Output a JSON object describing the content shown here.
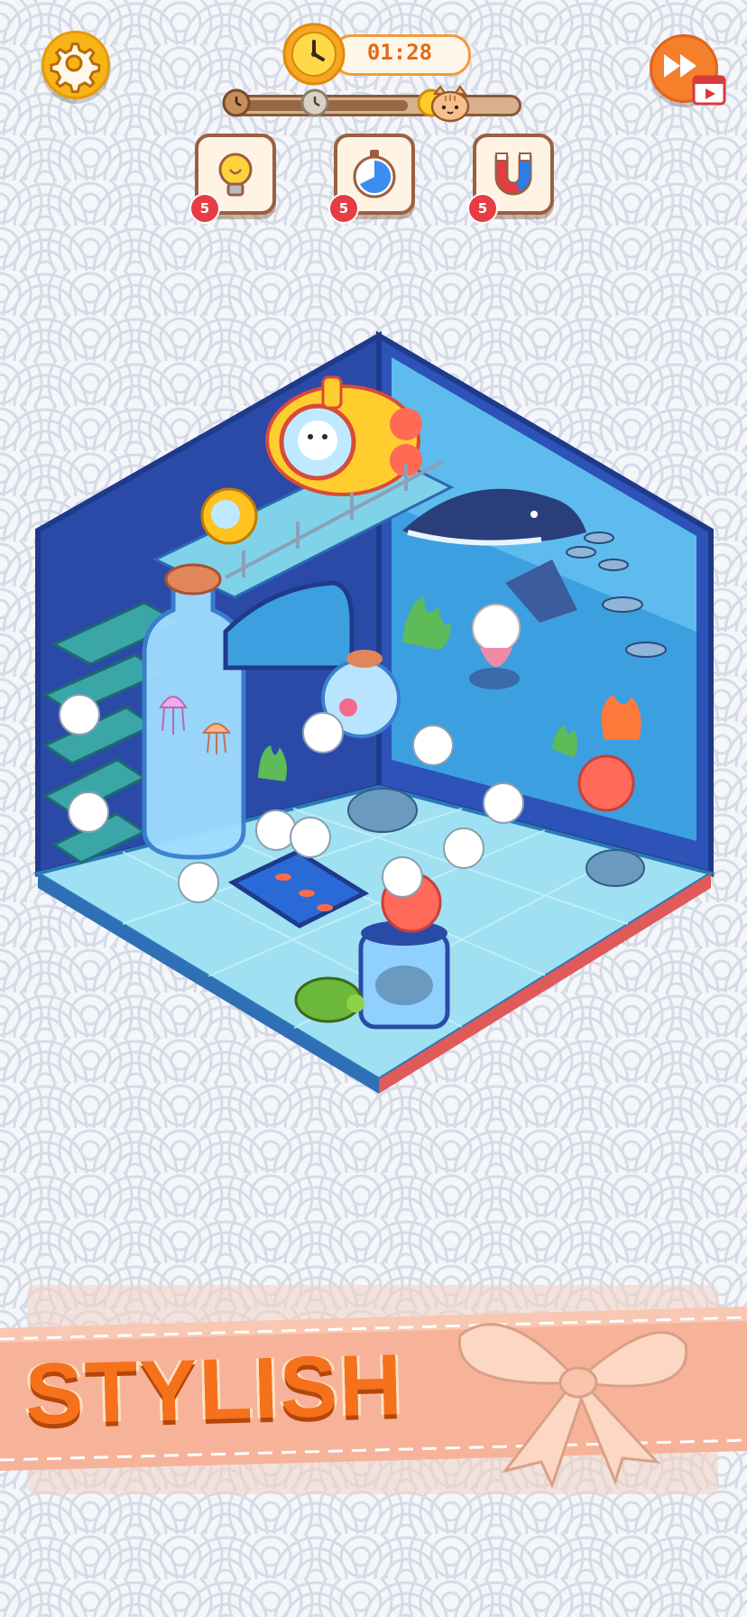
{
  "hud": {
    "timer_text": "01:28",
    "level_progress": 0.62,
    "milestones": 3
  },
  "boosters": [
    {
      "name": "hint",
      "icon": "lightbulb-icon",
      "count": "5"
    },
    {
      "name": "freeze-time",
      "icon": "stopwatch-icon",
      "count": "5"
    },
    {
      "name": "magnet",
      "icon": "magnet-icon",
      "count": "5"
    }
  ],
  "banner": {
    "text": "STYLISH"
  },
  "colors": {
    "accent_orange": "#f57f2a",
    "gold": "#f7b418",
    "room_blue": "#2e4fb8",
    "floor_cyan": "#9fe1f2",
    "banner_pink": "#f6b39a"
  }
}
